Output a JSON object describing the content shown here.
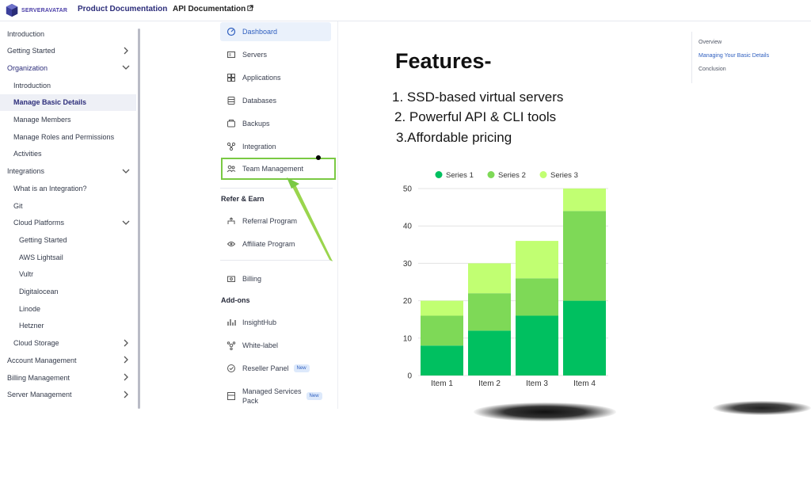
{
  "topnav": {
    "logo_text": "SERVERAVATAR",
    "product_docs": "Product Documentation",
    "api_docs": "API Documentation"
  },
  "sidebar": {
    "items": [
      {
        "label": "Introduction",
        "level": 0
      },
      {
        "label": "Getting Started",
        "level": 0,
        "chevron": "right"
      },
      {
        "label": "Organization",
        "level": 0,
        "chevron": "down",
        "highlight": true
      },
      {
        "label": "Introduction",
        "level": 1
      },
      {
        "label": "Manage Basic Details",
        "level": 1,
        "active": true
      },
      {
        "label": "Manage Members",
        "level": 1
      },
      {
        "label": "Manage Roles and Permissions",
        "level": 1
      },
      {
        "label": "Activities",
        "level": 1
      },
      {
        "label": "Integrations",
        "level": 0,
        "chevron": "down"
      },
      {
        "label": "What is an Integration?",
        "level": 1
      },
      {
        "label": "Git",
        "level": 1
      },
      {
        "label": "Cloud Platforms",
        "level": 1,
        "chevron": "down"
      },
      {
        "label": "Getting Started",
        "level": 2
      },
      {
        "label": "AWS Lightsail",
        "level": 2
      },
      {
        "label": "Vultr",
        "level": 2
      },
      {
        "label": "Digitalocean",
        "level": 2
      },
      {
        "label": "Linode",
        "level": 2
      },
      {
        "label": "Hetzner",
        "level": 2
      },
      {
        "label": "Cloud Storage",
        "level": 1,
        "chevron": "right"
      },
      {
        "label": "Account Management",
        "level": 0,
        "chevron": "right"
      },
      {
        "label": "Billing Management",
        "level": 0,
        "chevron": "right"
      },
      {
        "label": "Server Management",
        "level": 0,
        "chevron": "right"
      }
    ]
  },
  "midnav": {
    "items": [
      {
        "label": "Dashboard",
        "icon": "dashboard-icon",
        "active": true
      },
      {
        "label": "Servers",
        "icon": "servers-icon"
      },
      {
        "label": "Applications",
        "icon": "applications-icon"
      },
      {
        "label": "Databases",
        "icon": "databases-icon"
      },
      {
        "label": "Backups",
        "icon": "backups-icon"
      },
      {
        "label": "Integration",
        "icon": "integration-icon"
      },
      {
        "label": "Team Management",
        "icon": "team-icon"
      }
    ],
    "refer_heading": "Refer & Earn",
    "refer_items": [
      {
        "label": "Referral Program",
        "icon": "referral-icon"
      },
      {
        "label": "Affiliate Program",
        "icon": "affiliate-icon"
      }
    ],
    "billing_label": "Billing",
    "addons_heading": "Add-ons",
    "addon_items": [
      {
        "label": "InsightHub",
        "icon": "insighthub-icon"
      },
      {
        "label": "White-label",
        "icon": "whitelabel-icon"
      },
      {
        "label": "Reseller Panel",
        "icon": "reseller-icon",
        "badge": "New"
      },
      {
        "label": "Managed Services",
        "label2": "Pack",
        "icon": "managed-icon",
        "badge": "New"
      }
    ]
  },
  "toc": {
    "items": [
      "Overview",
      "Managing Your Basic Details",
      "Conclusion"
    ]
  },
  "features": {
    "title": "Features-",
    "items": [
      "1. SSD-based virtual servers",
      "2. Powerful API & CLI tools",
      "3.Affordable pricing"
    ]
  },
  "colors": {
    "series1": "#00c060",
    "series2": "#7ed957",
    "series3": "#c1ff72",
    "accent": "#7ac943",
    "brand": "#2c2d7a"
  },
  "chart_data": {
    "type": "bar",
    "stacked": true,
    "categories": [
      "Item 1",
      "Item 2",
      "Item 3",
      "Item 4"
    ],
    "series": [
      {
        "name": "Series 1",
        "values": [
          8,
          12,
          16,
          20
        ]
      },
      {
        "name": "Series 2",
        "values": [
          8,
          10,
          10,
          24
        ]
      },
      {
        "name": "Series 3",
        "values": [
          4,
          8,
          10,
          6
        ]
      }
    ],
    "ylim": [
      0,
      50
    ],
    "yticks": [
      0,
      10,
      20,
      30,
      40,
      50
    ],
    "legend": "top",
    "grid": true
  }
}
